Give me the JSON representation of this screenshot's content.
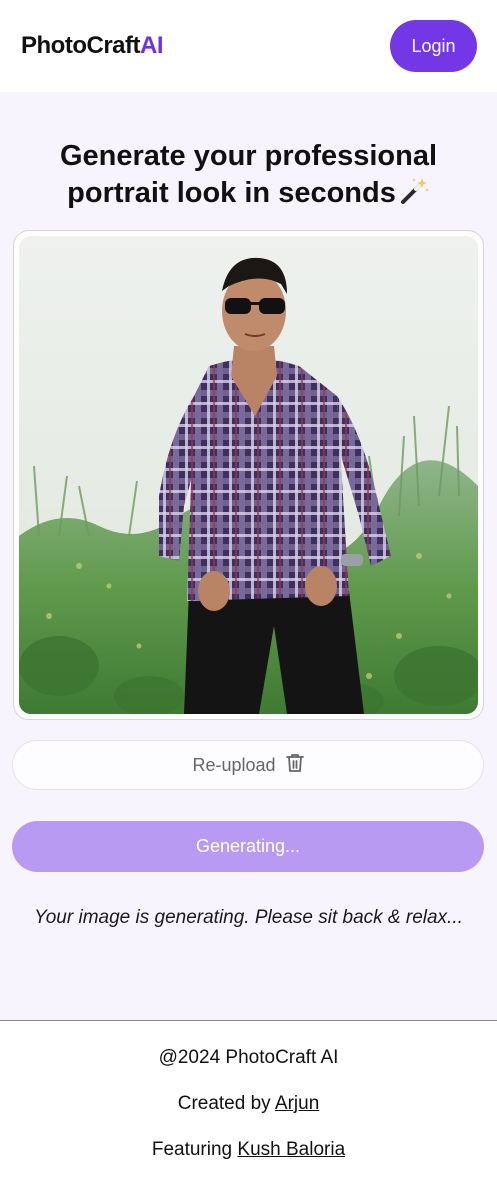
{
  "header": {
    "brand_main": "PhotoCraft",
    "brand_accent": "AI",
    "login_label": "Login"
  },
  "main": {
    "headline_line1": "Generate your professional",
    "headline_line2": "portrait look in seconds",
    "headline_icon": "magic-wand-icon",
    "reupload_label": "Re-upload",
    "reupload_icon": "trash-icon",
    "generate_label": "Generating...",
    "status_text": "Your image is generating. Please sit back & relax..."
  },
  "footer": {
    "copyright": "@2024 PhotoCraft AI",
    "created_prefix": "Created by",
    "created_name": "Arjun",
    "featuring_prefix": "Featuring",
    "featuring_name": "Kush Baloria"
  },
  "colors": {
    "brand_accent": "#6d33e0",
    "login_bg": "#7437e6",
    "generate_disabled_bg": "#b99af2",
    "main_bg": "#f8f4fe"
  }
}
